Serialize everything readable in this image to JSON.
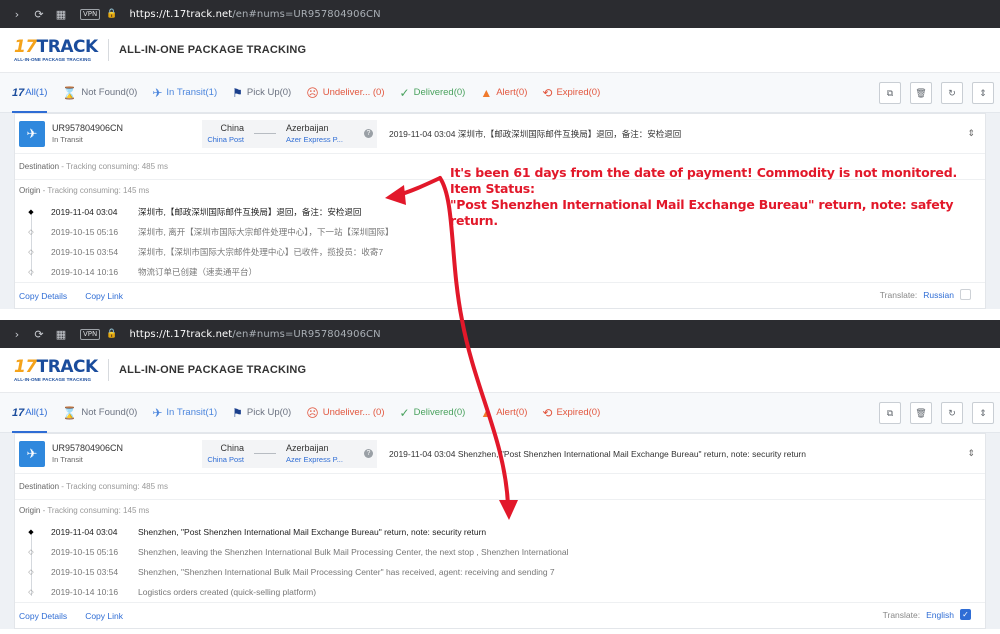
{
  "screens": {
    "top": {
      "browser": {
        "url_host": "https://t.17track.net",
        "url_path": "/en#nums=UR957804906CN",
        "vpn": "VPN"
      },
      "header": {
        "logo_17": "17",
        "logo_track": "TRACK",
        "logo_sub": "ALL-IN-ONE PACKAGE TRACKING",
        "title": "ALL-IN-ONE PACKAGE TRACKING"
      },
      "tabs": {
        "all": "All(1)",
        "not_found": "Not Found(0)",
        "in_transit": "In Transit(1)",
        "pick_up": "Pick Up(0)",
        "undelivered": "Undeliver... (0)",
        "delivered": "Delivered(0)",
        "alert": "Alert(0)",
        "expired": "Expired(0)"
      },
      "package": {
        "number": "UR957804906CN",
        "status": "In Transit",
        "origin_country": "China",
        "origin_carrier": "China Post",
        "dest_country": "Azerbaijan",
        "dest_carrier": "Azer Express P...",
        "latest": "2019-11-04 03:04  深圳市,【邮政深圳国际邮件互换局】退回，备注：安检退回"
      },
      "destination": {
        "label": "Destination",
        "consuming": "Tracking consuming: 485 ms"
      },
      "origin": {
        "label": "Origin",
        "consuming": "Tracking consuming: 145 ms"
      },
      "events": [
        {
          "time": "2019-11-04 03:04",
          "desc": "深圳市,【邮政深圳国际邮件互换局】退回，备注：安检退回"
        },
        {
          "time": "2019-10-15 05:16",
          "desc": "深圳市, 离开【深圳市国际大宗邮件处理中心】，下一站【深圳国际】"
        },
        {
          "time": "2019-10-15 03:54",
          "desc": "深圳市,【深圳市国际大宗邮件处理中心】已收件，揽投员：收寄7"
        },
        {
          "time": "2019-10-14 10:16",
          "desc": "物流订单已创建（速卖通平台）"
        }
      ],
      "footer": {
        "copy_details": "Copy Details",
        "copy_link": "Copy Link",
        "translate": "Translate:",
        "language": "Russian"
      }
    },
    "bottom": {
      "browser": {
        "url_host": "https://t.17track.net",
        "url_path": "/en#nums=UR957804906CN",
        "vpn": "VPN"
      },
      "header": {
        "logo_17": "17",
        "logo_track": "TRACK",
        "logo_sub": "ALL-IN-ONE PACKAGE TRACKING",
        "title": "ALL-IN-ONE PACKAGE TRACKING"
      },
      "tabs": {
        "all": "All(1)",
        "not_found": "Not Found(0)",
        "in_transit": "In Transit(1)",
        "pick_up": "Pick Up(0)",
        "undelivered": "Undeliver... (0)",
        "delivered": "Delivered(0)",
        "alert": "Alert(0)",
        "expired": "Expired(0)"
      },
      "package": {
        "number": "UR957804906CN",
        "status": "In Transit",
        "origin_country": "China",
        "origin_carrier": "China Post",
        "dest_country": "Azerbaijan",
        "dest_carrier": "Azer Express P...",
        "latest": "2019-11-04 03:04  Shenzhen, \"Post Shenzhen International Mail Exchange Bureau\" return, note: security return"
      },
      "destination": {
        "label": "Destination",
        "consuming": "Tracking consuming: 485 ms"
      },
      "origin": {
        "label": "Origin",
        "consuming": "Tracking consuming: 145 ms"
      },
      "events": [
        {
          "time": "2019-11-04 03:04",
          "desc": "Shenzhen, \"Post Shenzhen International Mail Exchange Bureau\" return, note: security return"
        },
        {
          "time": "2019-10-15 05:16",
          "desc": "Shenzhen, leaving the Shenzhen International Bulk Mail Processing Center, the next stop , Shenzhen International"
        },
        {
          "time": "2019-10-15 03:54",
          "desc": "Shenzhen, \"Shenzhen International Bulk Mail Processing Center\" has received, agent: receiving and sending 7"
        },
        {
          "time": "2019-10-14 10:16",
          "desc": "Logistics orders created (quick-selling platform)"
        }
      ],
      "footer": {
        "copy_details": "Copy Details",
        "copy_link": "Copy Link",
        "translate": "Translate:",
        "language": "English"
      }
    }
  },
  "annotation": {
    "line1": "It's been 61 days from the date of payment! Commodity is not monitored.",
    "line2": "Item Status:",
    "line3": "\"Post Shenzhen International Mail Exchange Bureau\" return, note: safety return.",
    "color": "#e2182a"
  },
  "colors": {
    "accent": "#2f6dd5",
    "brand_orange": "#f5a31a",
    "brand_blue": "#1a4c9c",
    "browser_bar": "#2b2c30"
  },
  "icons": [
    "back-icon",
    "refresh-icon",
    "grid-icon",
    "lock-icon",
    "hourglass-icon",
    "plane-icon",
    "flag-icon",
    "sad-face-icon",
    "check-icon",
    "warning-icon",
    "expired-icon",
    "copy-icon",
    "delete-icon",
    "sync-icon",
    "collapse-icon",
    "help-icon"
  ]
}
